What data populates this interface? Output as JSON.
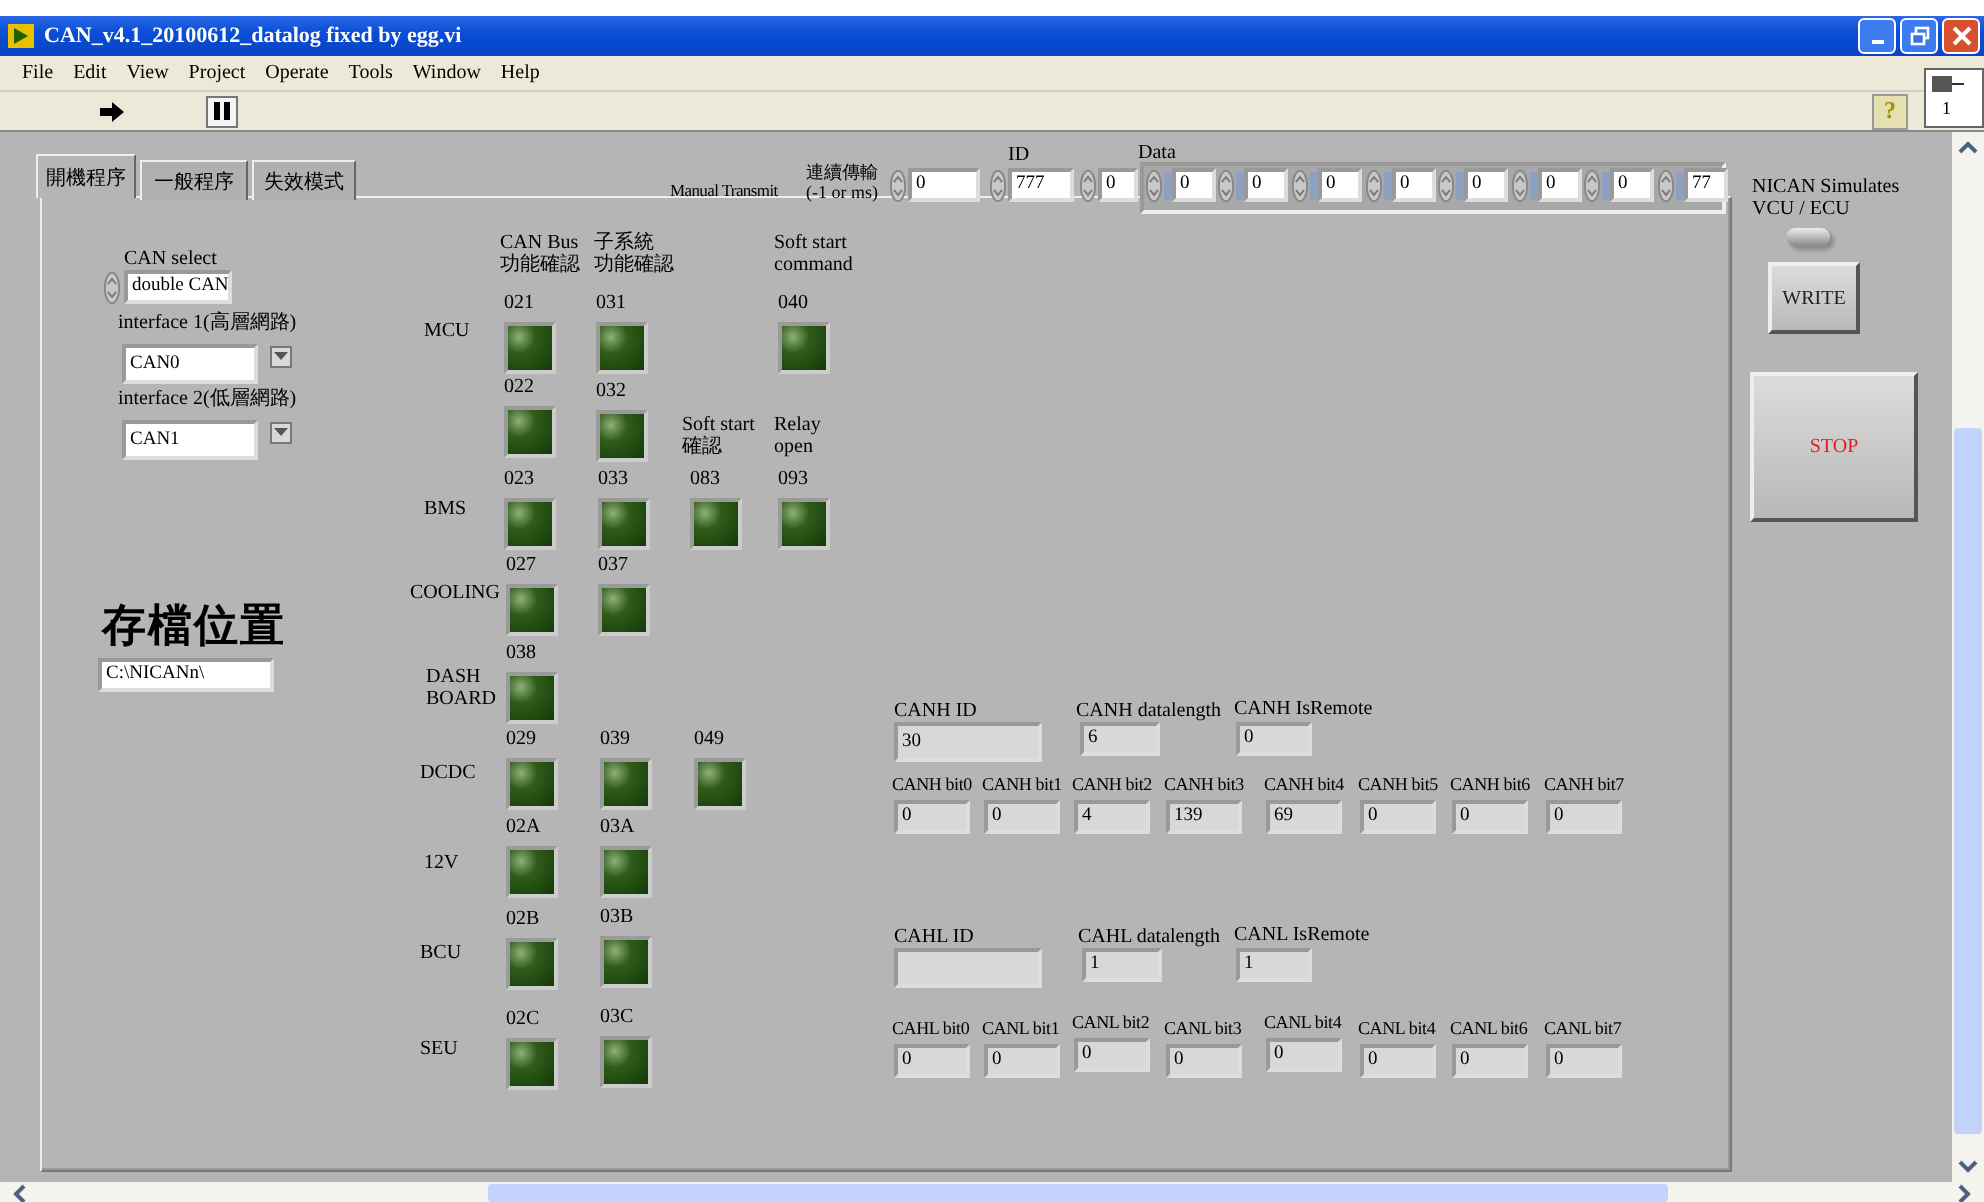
{
  "window": {
    "title": "CAN_v4.1_20100612_datalog fixed by egg.vi",
    "help_button": "?",
    "vi_icon_label": "1"
  },
  "menu": [
    "File",
    "Edit",
    "View",
    "Project",
    "Operate",
    "Tools",
    "Window",
    "Help"
  ],
  "tabs": [
    {
      "label": "開機程序",
      "selected": true
    },
    {
      "label": "一般程序",
      "selected": false
    },
    {
      "label": "失效模式",
      "selected": false
    }
  ],
  "manual_transmit": {
    "label": "Manual Transmit",
    "interval_label": [
      "連續傳輸",
      "(-1 or ms)"
    ],
    "interval_value": "0",
    "id_label": "ID",
    "id_value": "777",
    "extra_value": "0",
    "data_label": "Data",
    "data": [
      "0",
      "0",
      "0",
      "0",
      "0",
      "0",
      "0",
      "77"
    ]
  },
  "can_select": {
    "label": "CAN select",
    "value": "double CAN"
  },
  "interfaces": [
    {
      "label": "interface 1(高層網路)",
      "value": "CAN0"
    },
    {
      "label": "interface 2(低層網路)",
      "value": "CAN1"
    }
  ],
  "save_location": {
    "label": "存檔位置",
    "value": "C:\\NICANn\\"
  },
  "led_headers": [
    {
      "lines": [
        "CAN Bus",
        "功能確認"
      ]
    },
    {
      "lines": [
        "子系統",
        "功能確認"
      ]
    },
    {
      "lines": [
        "Soft start",
        "command"
      ]
    },
    {
      "lines": [
        "Soft start",
        "確認"
      ]
    },
    {
      "lines": [
        "Relay",
        "open"
      ]
    }
  ],
  "led_rows": [
    {
      "lines": [
        "MCU"
      ]
    },
    {
      "lines": [
        "BMS"
      ]
    },
    {
      "lines": [
        "COOLING"
      ]
    },
    {
      "lines": [
        "DASH",
        "BOARD"
      ]
    },
    {
      "lines": [
        "DCDC"
      ]
    },
    {
      "lines": [
        "12V"
      ]
    },
    {
      "lines": [
        "BCU"
      ]
    },
    {
      "lines": [
        "SEU"
      ]
    }
  ],
  "leds": [
    {
      "code": "021",
      "on": false
    },
    {
      "code": "031",
      "on": false
    },
    {
      "code": "040",
      "on": false
    },
    {
      "code": "022",
      "on": false
    },
    {
      "code": "032",
      "on": false
    },
    {
      "code": "023",
      "on": false
    },
    {
      "code": "033",
      "on": false
    },
    {
      "code": "083",
      "on": false
    },
    {
      "code": "093",
      "on": false
    },
    {
      "code": "027",
      "on": false
    },
    {
      "code": "037",
      "on": false
    },
    {
      "code": "038",
      "on": false
    },
    {
      "code": "029",
      "on": false
    },
    {
      "code": "039",
      "on": false
    },
    {
      "code": "049",
      "on": false
    },
    {
      "code": "02A",
      "on": false
    },
    {
      "code": "03A",
      "on": false
    },
    {
      "code": "02B",
      "on": false
    },
    {
      "code": "03B",
      "on": false
    },
    {
      "code": "02C",
      "on": false
    },
    {
      "code": "03C",
      "on": false
    }
  ],
  "canh": {
    "id_label": "CANH ID",
    "id_value": "30",
    "length_label": "CANH datalength",
    "length_value": "6",
    "remote_label": "CANH IsRemote",
    "remote_value": "0",
    "bits": [
      {
        "label": "CANH bit0",
        "value": "0"
      },
      {
        "label": "CANH bit1",
        "value": "0"
      },
      {
        "label": "CANH bit2",
        "value": "4"
      },
      {
        "label": "CANH bit3",
        "value": "139"
      },
      {
        "label": "CANH bit4",
        "value": "69"
      },
      {
        "label": "CANH bit5",
        "value": "0"
      },
      {
        "label": "CANH bit6",
        "value": "0"
      },
      {
        "label": "CANH bit7",
        "value": "0"
      }
    ]
  },
  "canl": {
    "id_label": "CAHL ID",
    "length_label": "CAHL datalength",
    "length_value": "1",
    "remote_label": "CANL IsRemote",
    "remote_value": "1",
    "bits": [
      {
        "label": "CAHL bit0",
        "value": "0"
      },
      {
        "label": "CANL bit1",
        "value": "0"
      },
      {
        "label": "CANL bit2",
        "value": "0"
      },
      {
        "label": "CANL bit3",
        "value": "0"
      },
      {
        "label": "CANL bit4",
        "value": "0"
      },
      {
        "label": "CANL bit4",
        "value": "0"
      },
      {
        "label": "CANL bit6",
        "value": "0"
      },
      {
        "label": "CANL bit7",
        "value": "0"
      }
    ]
  },
  "simulate": {
    "label": [
      "NICAN Simulates",
      "VCU / ECU"
    ],
    "on": false
  },
  "buttons": {
    "write": "WRITE",
    "stop": "STOP"
  }
}
